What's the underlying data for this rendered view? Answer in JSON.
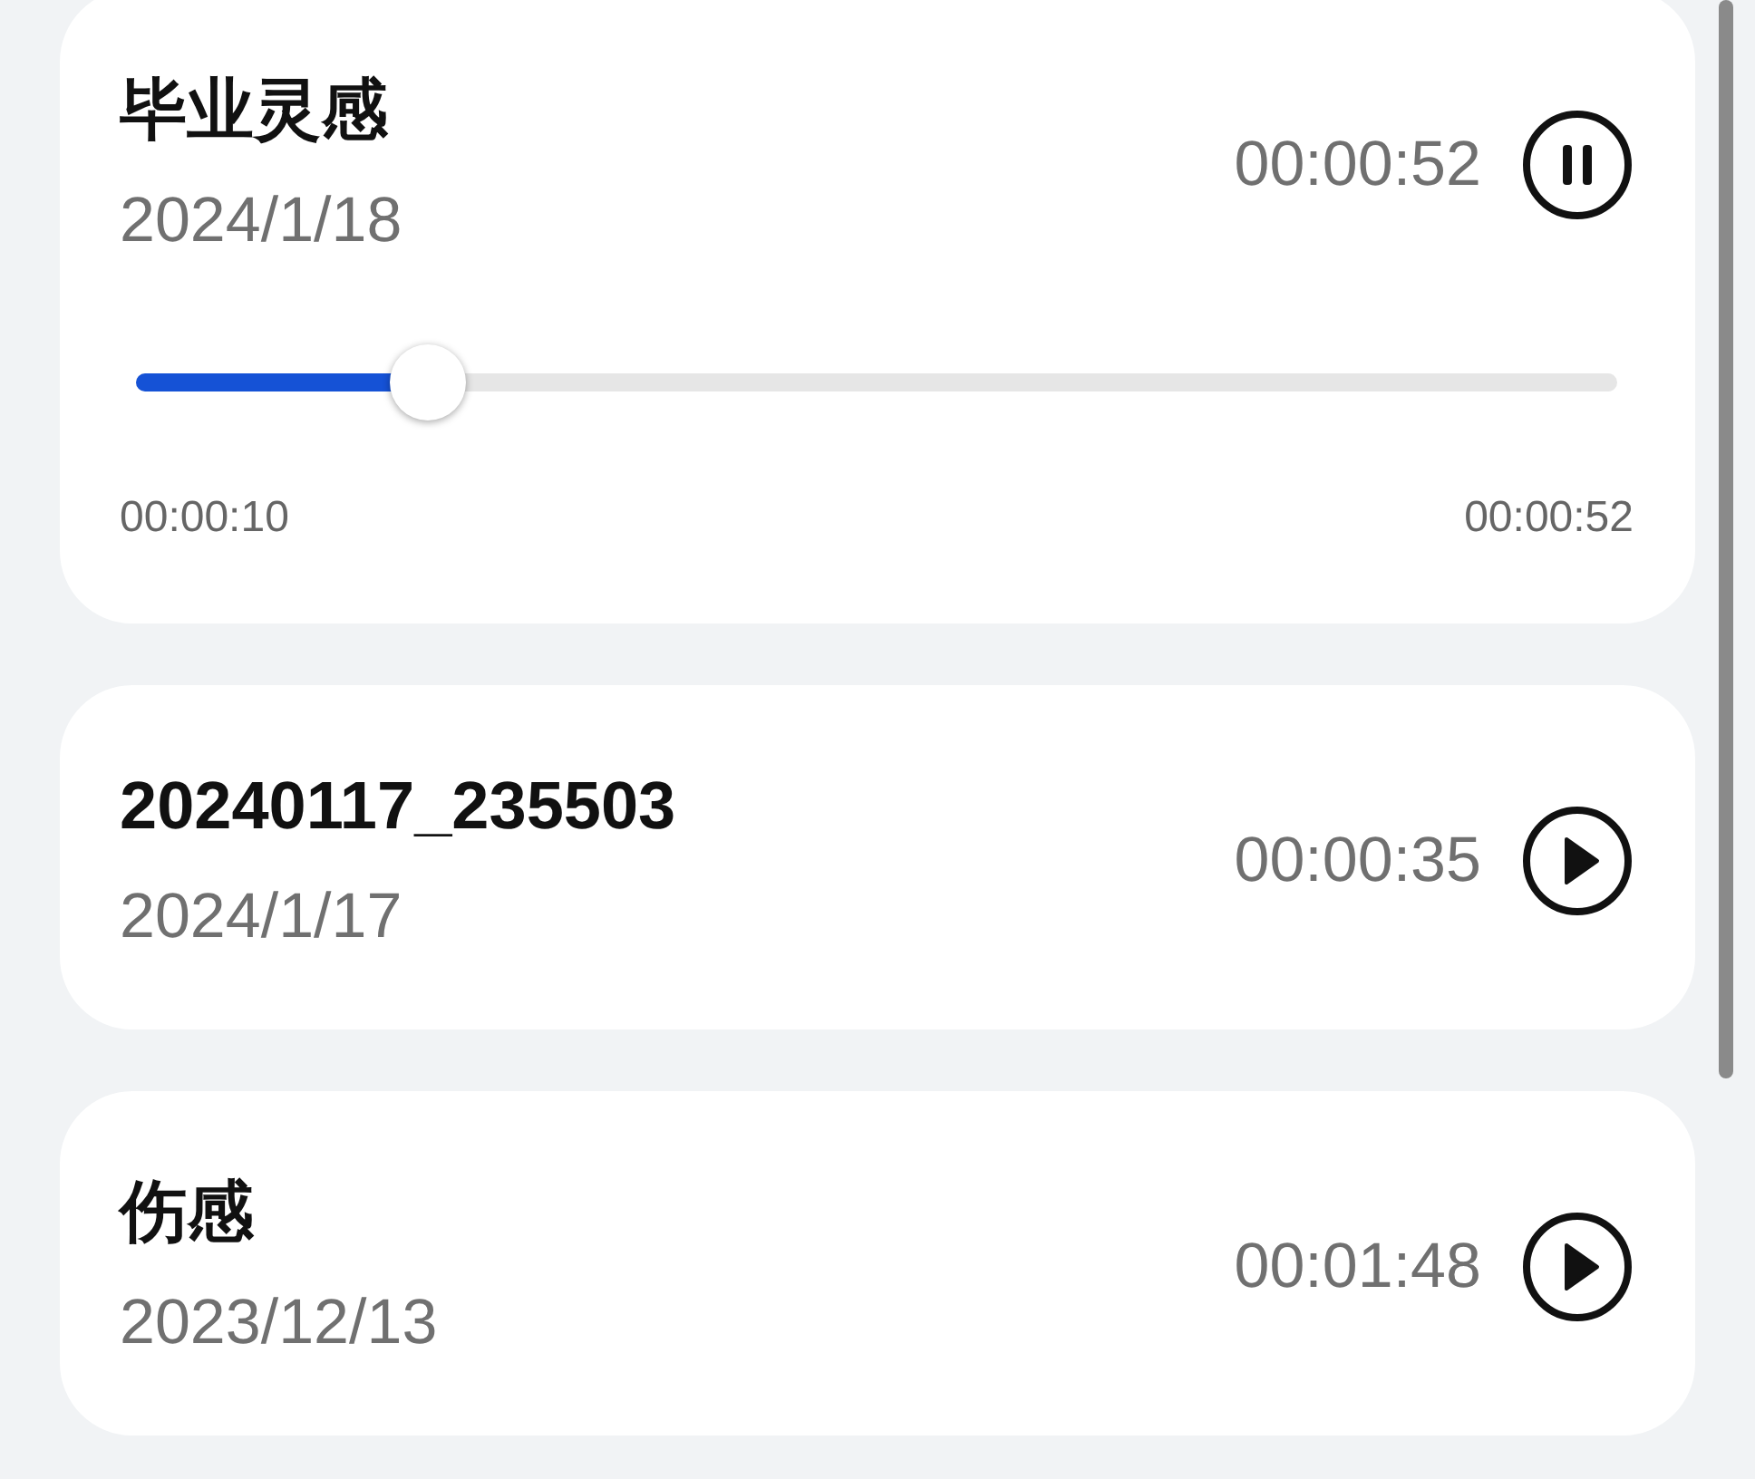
{
  "recordings": [
    {
      "title": "毕业灵感",
      "date": "2024/1/18",
      "duration": "00:00:52",
      "playing": true,
      "player": {
        "level": 0.197,
        "elapsed": "00:00:10",
        "total": "00:00:52"
      }
    },
    {
      "title": "20240117_235503",
      "date": "2024/1/17",
      "duration": "00:00:35",
      "playing": false
    },
    {
      "title": "伤感",
      "date": "2023/12/13",
      "duration": "00:01:48",
      "playing": false
    }
  ]
}
